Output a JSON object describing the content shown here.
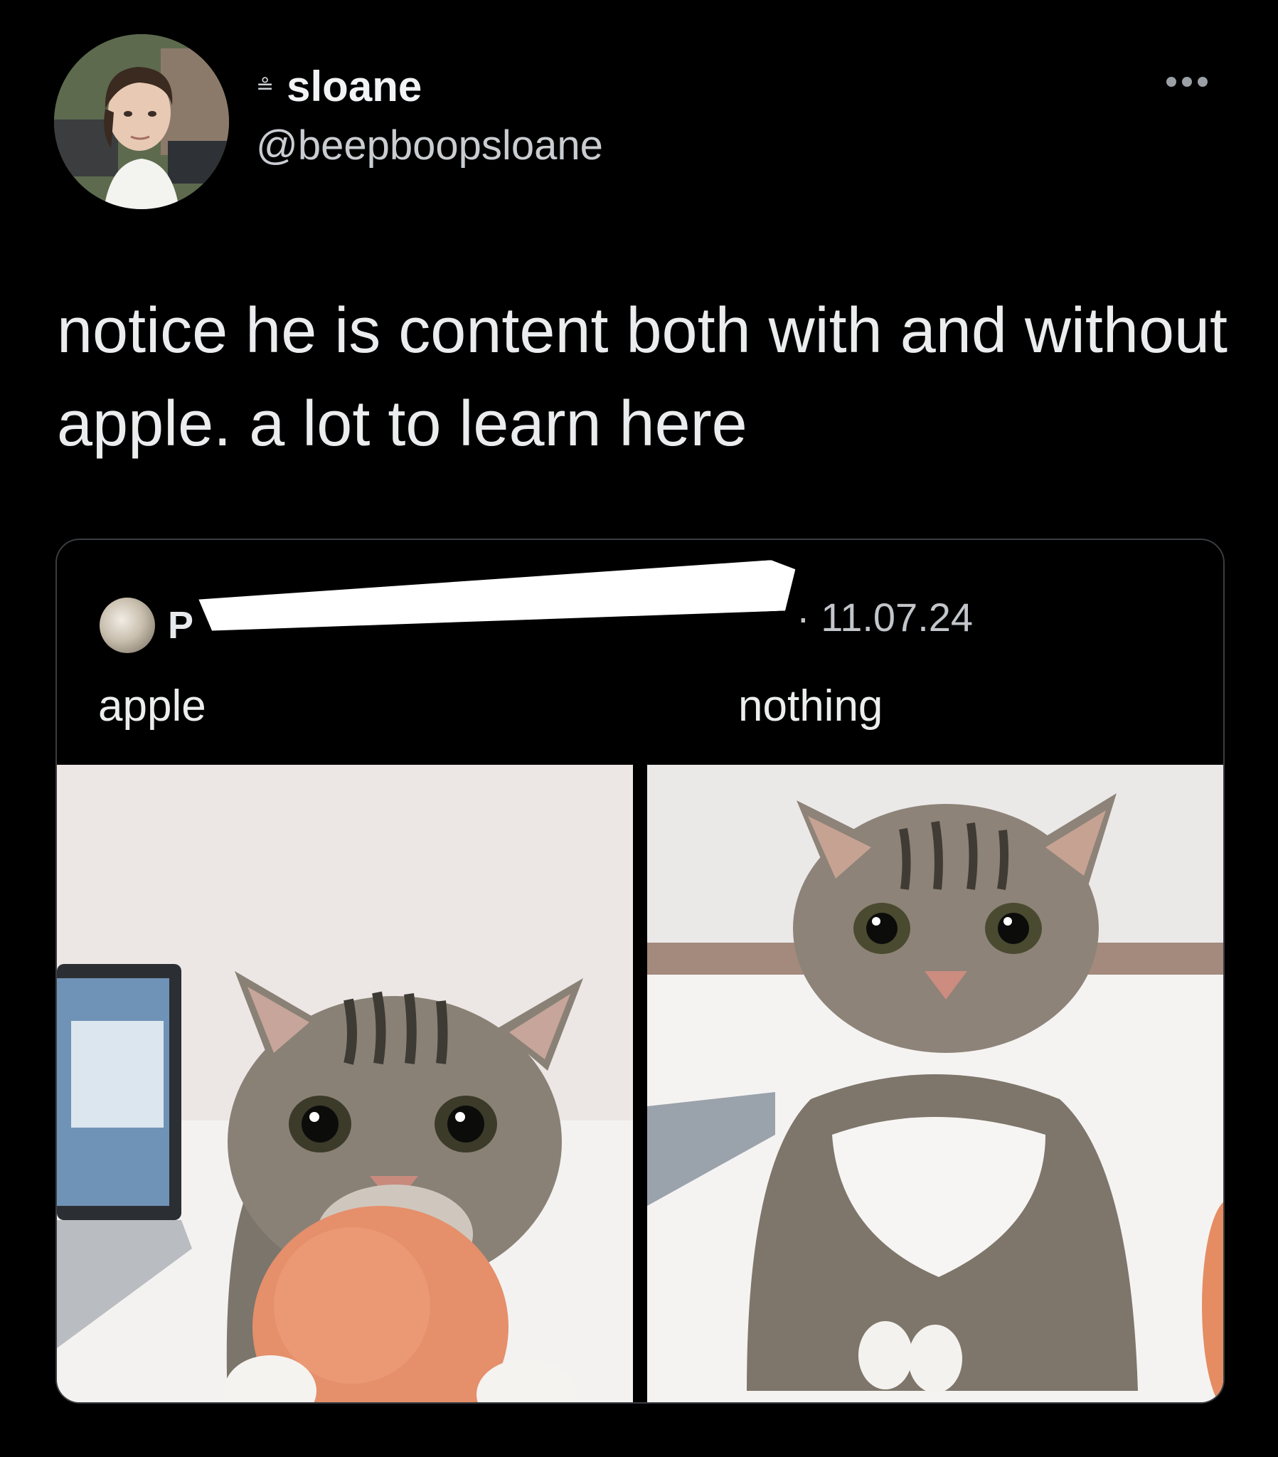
{
  "author": {
    "display_name": "sloane",
    "handle": "@beepboopsloane",
    "status_emoji": "≗"
  },
  "tweet": {
    "text": "notice he is content both with and without apple. a lot to learn here"
  },
  "quoted_tweet": {
    "name_visible": "P",
    "date": "· 11.07.24",
    "label_left": "apple",
    "label_right": "nothing"
  }
}
